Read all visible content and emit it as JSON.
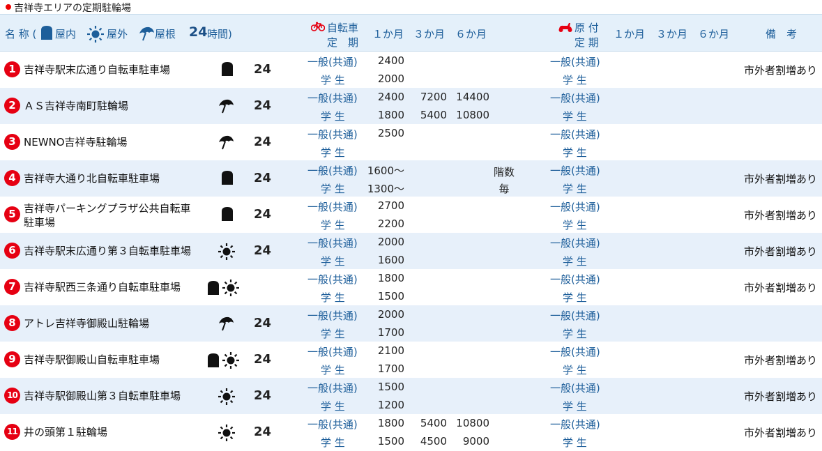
{
  "title": "吉祥寺エリアの定期駐輪場",
  "header": {
    "name": "名 称 (",
    "indoor": "屋内",
    "outdoor": "屋外",
    "roof": "屋根",
    "hours_num": "24",
    "hours_suffix": "時間)",
    "bike_line1": "自転車",
    "bike_line2": "定　期",
    "m1": "１か月",
    "m3": "３か月",
    "m6": "６か月",
    "moped_line1": "原 付",
    "moped_line2": "定 期",
    "m1b": "１か月",
    "m3b": "３か月",
    "m6b": "６か月",
    "remarks": "備　考"
  },
  "labels": {
    "general": "一般(共通)",
    "student": "学 生"
  },
  "colors": {
    "number_badge": "#e60012",
    "header_bg": "#e4f0fa",
    "alt_row_bg": "#e7f0fa",
    "label_blue": "#1d5e9a"
  },
  "rows": [
    {
      "num": "1",
      "name": "吉祥寺駅末広通り自転車駐車場",
      "icons": [
        "indoor"
      ],
      "hours": "24",
      "gen1": "2400",
      "gen3": "",
      "gen6": "",
      "stu1": "2000",
      "stu3": "",
      "stu6": "",
      "extra": "",
      "note": "市外者割増あり"
    },
    {
      "num": "2",
      "name": "ＡＳ吉祥寺南町駐輪場",
      "icons": [
        "roof"
      ],
      "hours": "24",
      "gen1": "2400",
      "gen3": "7200",
      "gen6": "14400",
      "stu1": "1800",
      "stu3": "5400",
      "stu6": "10800",
      "extra": "",
      "note": ""
    },
    {
      "num": "3",
      "name": "NEWNO吉祥寺駐輪場",
      "icons": [
        "roof"
      ],
      "hours": "24",
      "gen1": "2500",
      "gen3": "",
      "gen6": "",
      "stu1": "",
      "stu3": "",
      "stu6": "",
      "extra": "",
      "note": ""
    },
    {
      "num": "4",
      "name": "吉祥寺大通り北自転車駐車場",
      "icons": [
        "indoor"
      ],
      "hours": "24",
      "gen1": "1600～",
      "gen3": "",
      "gen6": "",
      "stu1": "1300～",
      "stu3": "",
      "stu6": "",
      "extra": "階数毎",
      "note": "市外者割増あり"
    },
    {
      "num": "5",
      "name": "吉祥寺パーキングプラザ公共自転車駐車場",
      "icons": [
        "indoor"
      ],
      "hours": "24",
      "gen1": "2700",
      "gen3": "",
      "gen6": "",
      "stu1": "2200",
      "stu3": "",
      "stu6": "",
      "extra": "",
      "note": "市外者割増あり"
    },
    {
      "num": "6",
      "name": "吉祥寺駅末広通り第３自転車駐車場",
      "icons": [
        "outdoor"
      ],
      "hours": "24",
      "gen1": "2000",
      "gen3": "",
      "gen6": "",
      "stu1": "1600",
      "stu3": "",
      "stu6": "",
      "extra": "",
      "note": "市外者割増あり"
    },
    {
      "num": "7",
      "name": "吉祥寺駅西三条通り自転車駐車場",
      "icons": [
        "indoor",
        "outdoor"
      ],
      "hours": "",
      "gen1": "1800",
      "gen3": "",
      "gen6": "",
      "stu1": "1500",
      "stu3": "",
      "stu6": "",
      "extra": "",
      "note": "市外者割増あり"
    },
    {
      "num": "8",
      "name": "アトレ吉祥寺御殿山駐輪場",
      "icons": [
        "roof"
      ],
      "hours": "24",
      "gen1": "2000",
      "gen3": "",
      "gen6": "",
      "stu1": "1700",
      "stu3": "",
      "stu6": "",
      "extra": "",
      "note": ""
    },
    {
      "num": "9",
      "name": "吉祥寺駅御殿山自転車駐車場",
      "icons": [
        "indoor",
        "outdoor"
      ],
      "hours": "24",
      "gen1": "2100",
      "gen3": "",
      "gen6": "",
      "stu1": "1700",
      "stu3": "",
      "stu6": "",
      "extra": "",
      "note": "市外者割増あり"
    },
    {
      "num": "10",
      "name": "吉祥寺駅御殿山第３自転車駐車場",
      "icons": [
        "outdoor"
      ],
      "hours": "24",
      "gen1": "1500",
      "gen3": "",
      "gen6": "",
      "stu1": "1200",
      "stu3": "",
      "stu6": "",
      "extra": "",
      "note": "市外者割増あり"
    },
    {
      "num": "11",
      "name": "井の頭第１駐輪場",
      "icons": [
        "outdoor"
      ],
      "hours": "24",
      "gen1": "1800",
      "gen3": "5400",
      "gen6": "10800",
      "stu1": "1500",
      "stu3": "4500",
      "stu6": "9000",
      "extra": "",
      "note": "市外者割増あり"
    }
  ]
}
